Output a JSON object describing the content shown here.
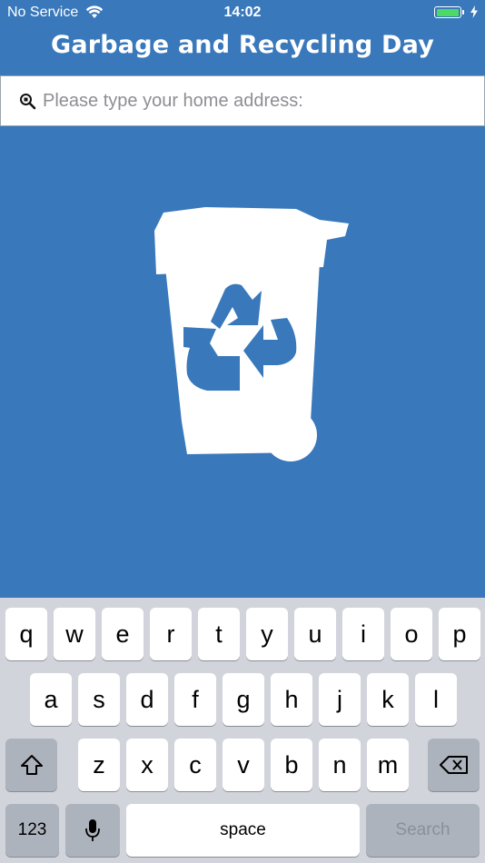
{
  "status_bar": {
    "carrier": "No Service",
    "time": "14:02",
    "battery_color": "#4cd964"
  },
  "header": {
    "title": "Garbage and Recycling Day"
  },
  "search": {
    "placeholder": "Please type your home address:",
    "value": "",
    "icon": "search-icon"
  },
  "hero": {
    "icon": "recycling-bin-icon",
    "background": "#3878bb"
  },
  "keyboard": {
    "row1": [
      "q",
      "w",
      "e",
      "r",
      "t",
      "y",
      "u",
      "i",
      "o",
      "p"
    ],
    "row2": [
      "a",
      "s",
      "d",
      "f",
      "g",
      "h",
      "j",
      "k",
      "l"
    ],
    "row3": [
      "z",
      "x",
      "c",
      "v",
      "b",
      "n",
      "m"
    ],
    "numbers_label": "123",
    "space_label": "space",
    "search_label": "Search",
    "shift_icon": "shift-icon",
    "delete_icon": "delete-icon",
    "mic_icon": "microphone-icon"
  }
}
